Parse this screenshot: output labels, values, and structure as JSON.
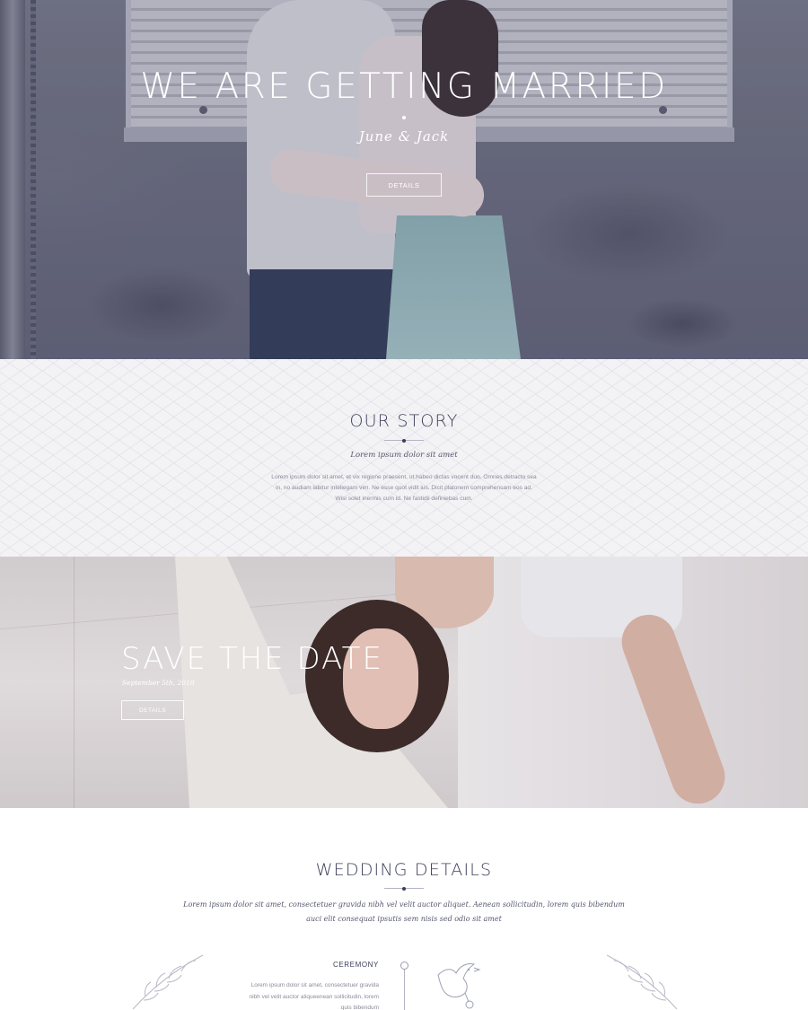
{
  "hero": {
    "title": "WE ARE GETTING MARRIED",
    "names": "June & Jack",
    "button_label": "DETAILS"
  },
  "story": {
    "title": "OUR STORY",
    "subtitle": "Lorem ipsum dolor sit amet",
    "body": "Lorem ipsum dolor sit amet, et vix regione praesent, ut habeo dictas vocent duo. Omnes detracto sea in, no audiam labitur intellegam vim. Ne esse quot vidit ius. Dicit platonem comprehensam eos ad. Wisi solet inermis cum id. Ne fastidii definiebas cum."
  },
  "save_the_date": {
    "title": "SAVE THE DATE",
    "date": "September 5th, 2018",
    "button_label": "DETAILS"
  },
  "wedding_details": {
    "title": "WEDDING DETAILS",
    "intro": "Lorem ipsum dolor sit amet, consectetuer gravida nibh vel velit auctor aliquet. Aenean sollicitudin, lorem quis bibendum auci elit consequat ipsutis sem nisis sed odio sit amet",
    "ceremony": {
      "title": "CEREMONY",
      "body": "Lorem ipsum dolor sit amet, consectetuer gravida nibh vel velit auctor aliqueenean sollicitudin, lorem quis bibendum"
    }
  },
  "colors": {
    "text_dark": "#3d3f5a",
    "text_muted": "#8a8b9c",
    "story_bg": "#f3f2f5",
    "white": "#ffffff"
  }
}
